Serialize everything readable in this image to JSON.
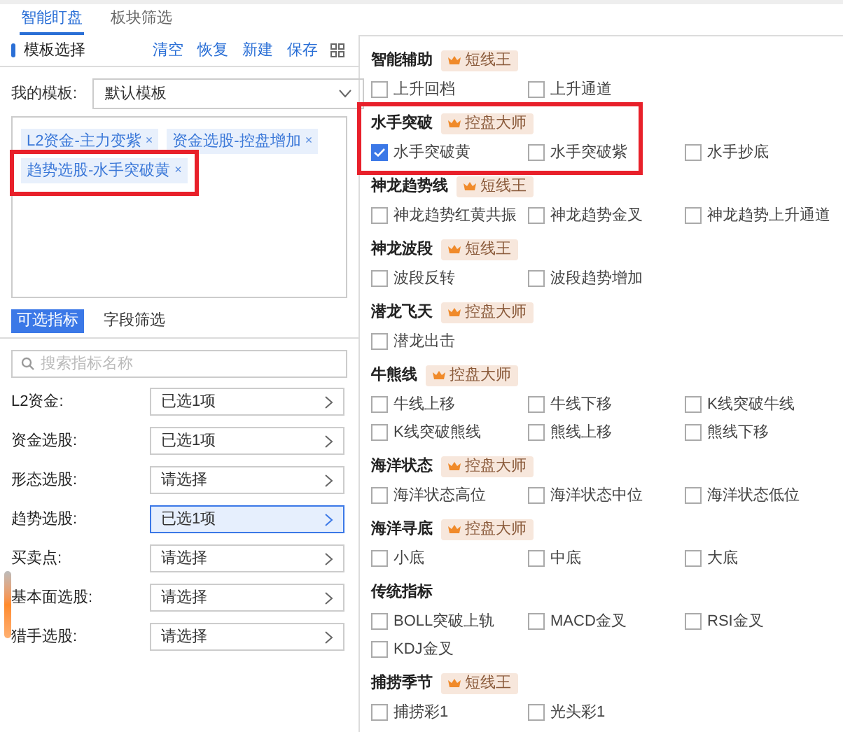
{
  "top_tabs": [
    {
      "label": "智能盯盘",
      "selected": true
    },
    {
      "label": "板块筛选",
      "selected": false
    }
  ],
  "template_header": {
    "title": "模板选择",
    "actions": [
      "清空",
      "恢复",
      "新建",
      "保存"
    ]
  },
  "my_template": {
    "label": "我的模板:",
    "value": "默认模板"
  },
  "selected_tags": [
    {
      "label": "L2资金-主力变紫",
      "remove": "×",
      "highlighted": false
    },
    {
      "label": "资金选股-控盘增加",
      "remove": "×",
      "highlighted": false
    },
    {
      "label": "趋势选股-水手突破黄",
      "remove": "×",
      "highlighted": true
    }
  ],
  "sub_tabs": [
    {
      "label": "可选指标",
      "selected": true
    },
    {
      "label": "字段筛选",
      "selected": false
    }
  ],
  "search": {
    "placeholder": "搜索指标名称"
  },
  "indicator_rows": [
    {
      "label": "L2资金:",
      "value": "已选1项",
      "selected": false
    },
    {
      "label": "资金选股:",
      "value": "已选1项",
      "selected": false
    },
    {
      "label": "形态选股:",
      "value": "请选择",
      "selected": false
    },
    {
      "label": "趋势选股:",
      "value": "已选1项",
      "selected": true
    },
    {
      "label": "买卖点:",
      "value": "请选择",
      "selected": false
    },
    {
      "label": "基本面选股:",
      "value": "请选择",
      "selected": false
    },
    {
      "label": "猎手选股:",
      "value": "请选择",
      "selected": false
    }
  ],
  "groups": [
    {
      "title": "智能辅助",
      "badge": "短线王",
      "highlighted": false,
      "options": [
        {
          "label": "上升回档",
          "checked": false
        },
        {
          "label": "上升通道",
          "checked": false
        }
      ]
    },
    {
      "title": "水手突破",
      "badge": "控盘大师",
      "highlighted": true,
      "options": [
        {
          "label": "水手突破黄",
          "checked": true
        },
        {
          "label": "水手突破紫",
          "checked": false
        },
        {
          "label": "水手抄底",
          "checked": false
        }
      ]
    },
    {
      "title": "神龙趋势线",
      "badge": "短线王",
      "highlighted": false,
      "options": [
        {
          "label": "神龙趋势红黄共振",
          "checked": false
        },
        {
          "label": "神龙趋势金叉",
          "checked": false
        },
        {
          "label": "神龙趋势上升通道",
          "checked": false
        }
      ]
    },
    {
      "title": "神龙波段",
      "badge": "短线王",
      "highlighted": false,
      "options": [
        {
          "label": "波段反转",
          "checked": false
        },
        {
          "label": "波段趋势增加",
          "checked": false
        }
      ]
    },
    {
      "title": "潜龙飞天",
      "badge": "控盘大师",
      "highlighted": false,
      "options": [
        {
          "label": "潜龙出击",
          "checked": false
        }
      ]
    },
    {
      "title": "牛熊线",
      "badge": "控盘大师",
      "highlighted": false,
      "options": [
        {
          "label": "牛线上移",
          "checked": false
        },
        {
          "label": "牛线下移",
          "checked": false
        },
        {
          "label": "K线突破牛线",
          "checked": false
        },
        {
          "label": "K线突破熊线",
          "checked": false
        },
        {
          "label": "熊线上移",
          "checked": false
        },
        {
          "label": "熊线下移",
          "checked": false
        }
      ]
    },
    {
      "title": "海洋状态",
      "badge": "控盘大师",
      "highlighted": false,
      "options": [
        {
          "label": "海洋状态高位",
          "checked": false
        },
        {
          "label": "海洋状态中位",
          "checked": false
        },
        {
          "label": "海洋状态低位",
          "checked": false
        }
      ]
    },
    {
      "title": "海洋寻底",
      "badge": "控盘大师",
      "highlighted": false,
      "options": [
        {
          "label": "小底",
          "checked": false
        },
        {
          "label": "中底",
          "checked": false
        },
        {
          "label": "大底",
          "checked": false
        }
      ]
    },
    {
      "title": "传统指标",
      "highlighted": false,
      "options": [
        {
          "label": "BOLL突破上轨",
          "checked": false
        },
        {
          "label": "MACD金叉",
          "checked": false
        },
        {
          "label": "RSI金叉",
          "checked": false
        },
        {
          "label": "KDJ金叉",
          "checked": false
        }
      ]
    },
    {
      "title": "捕捞季节",
      "badge": "短线王",
      "highlighted": false,
      "options": [
        {
          "label": "捕捞彩1",
          "checked": false
        },
        {
          "label": "光头彩1",
          "checked": false
        }
      ]
    }
  ]
}
